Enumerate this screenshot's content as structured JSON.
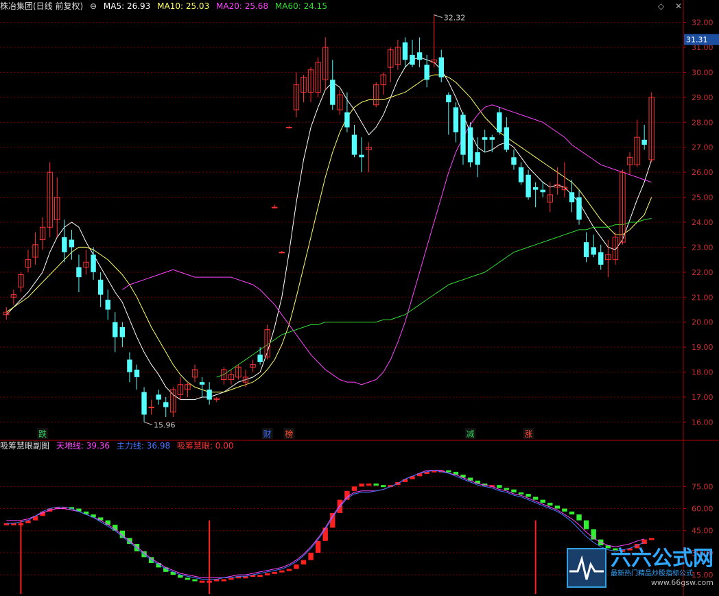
{
  "header": {
    "title": "株冶集团(日线 前复权)",
    "ma5_label": "MA5: 26.93",
    "ma10_label": "MA10: 25.03",
    "ma20_label": "MA20: 25.68",
    "ma60_label": "MA60: 24.15",
    "icons": [
      "diamond-icon",
      "close-icon"
    ]
  },
  "sub_header": {
    "title": "吸筹慧眼副图",
    "tiandi_label": "天地线: 39.36",
    "zhuli_label": "主力线: 36.98",
    "xichou_label": "吸筹慧眼: 0.00"
  },
  "current_price": "31.31",
  "high_label": "32.32",
  "low_label": "15.96",
  "watermark": {
    "title": "六六公式网",
    "slogan": "最新热门精品炒股指标公式",
    "url": "www.66gsw.com"
  },
  "colors": {
    "up": "#ff3232",
    "down": "#54ffff",
    "ma5": "#ffffff",
    "ma10": "#ffff66",
    "ma20": "#ff44ff",
    "ma60": "#33dd33",
    "tiandi": "#ff44ff",
    "zhuli": "#4477ff",
    "grid": "#7a0000",
    "axis": "#b00000"
  },
  "chart_data": [
    {
      "type": "candlestick",
      "title": "株冶集团(日线 前复权)",
      "ylim": [
        15.6,
        32.4
      ],
      "y_ticks": [
        "16.00",
        "17.00",
        "18.00",
        "19.00",
        "20.00",
        "21.00",
        "22.00",
        "23.00",
        "24.00",
        "25.00",
        "26.00",
        "27.00",
        "28.00",
        "29.00",
        "30.00",
        "31.00",
        "32.00"
      ],
      "candles": [
        [
          20.3,
          20.6,
          20.1,
          20.4
        ],
        [
          21.0,
          21.3,
          20.7,
          21.1
        ],
        [
          21.4,
          22.0,
          21.2,
          21.9
        ],
        [
          22.2,
          22.9,
          22.0,
          22.5
        ],
        [
          22.6,
          23.6,
          22.3,
          23.1
        ],
        [
          23.3,
          24.2,
          22.9,
          23.8
        ],
        [
          23.8,
          26.4,
          23.4,
          26.0
        ],
        [
          24.1,
          25.8,
          23.4,
          25.0
        ],
        [
          23.4,
          24.1,
          22.4,
          22.8
        ],
        [
          23.3,
          23.7,
          22.5,
          23.0
        ],
        [
          22.2,
          22.7,
          21.2,
          21.8
        ],
        [
          22.2,
          22.9,
          21.9,
          22.4
        ],
        [
          22.7,
          23.0,
          21.7,
          22.0
        ],
        [
          21.7,
          22.0,
          20.6,
          21.1
        ],
        [
          20.9,
          21.3,
          20.1,
          20.5
        ],
        [
          20.0,
          20.4,
          18.8,
          19.4
        ],
        [
          19.8,
          20.0,
          19.0,
          19.4
        ],
        [
          18.5,
          18.8,
          17.6,
          18.0
        ],
        [
          18.1,
          18.3,
          17.3,
          17.8
        ],
        [
          17.2,
          17.4,
          16.0,
          16.3
        ],
        [
          16.6,
          16.9,
          16.3,
          16.6
        ],
        [
          17.1,
          17.3,
          16.7,
          16.9
        ],
        [
          16.8,
          17.0,
          16.2,
          16.6
        ],
        [
          16.4,
          17.4,
          16.2,
          17.3
        ],
        [
          17.1,
          17.8,
          16.9,
          17.5
        ],
        [
          17.3,
          17.6,
          17.0,
          17.5
        ],
        [
          17.8,
          18.3,
          17.6,
          18.1
        ],
        [
          17.6,
          17.8,
          17.0,
          17.5
        ],
        [
          17.3,
          17.6,
          16.7,
          16.9
        ],
        [
          16.9,
          17.0,
          16.8,
          16.95
        ],
        [
          17.7,
          18.2,
          17.5,
          18.1
        ],
        [
          17.7,
          18.1,
          17.5,
          17.9
        ],
        [
          17.8,
          18.3,
          17.7,
          18.2
        ],
        [
          17.6,
          18.1,
          17.4,
          17.8
        ],
        [
          18.2,
          18.5,
          18.0,
          18.3
        ],
        [
          18.7,
          19.0,
          18.3,
          18.4
        ],
        [
          18.6,
          19.9,
          18.5,
          19.7
        ],
        [
          24.6,
          24.7,
          24.55,
          24.6
        ],
        [
          22.8,
          22.85,
          22.75,
          22.8
        ],
        [
          27.8,
          27.85,
          27.75,
          27.8
        ],
        [
          28.5,
          30.0,
          28.2,
          29.5
        ],
        [
          29.2,
          29.9,
          28.8,
          29.8
        ],
        [
          29.2,
          30.2,
          28.8,
          30.1
        ],
        [
          29.2,
          30.6,
          29.0,
          30.4
        ],
        [
          29.7,
          31.4,
          29.3,
          31.0
        ],
        [
          29.7,
          30.5,
          28.5,
          28.7
        ],
        [
          28.5,
          29.3,
          28.3,
          29.1
        ],
        [
          28.4,
          29.2,
          27.6,
          27.8
        ],
        [
          27.5,
          27.9,
          26.6,
          26.7
        ],
        [
          26.7,
          27.4,
          26.0,
          26.6
        ],
        [
          26.9,
          27.2,
          26.0,
          27.0
        ],
        [
          28.7,
          29.6,
          28.6,
          29.5
        ],
        [
          29.5,
          30.0,
          29.1,
          29.9
        ],
        [
          30.2,
          31.0,
          29.6,
          30.9
        ],
        [
          30.3,
          31.3,
          30.1,
          31.0
        ],
        [
          31.2,
          31.4,
          30.2,
          30.5
        ],
        [
          30.7,
          31.3,
          30.2,
          30.3
        ],
        [
          30.8,
          31.4,
          30.2,
          30.5
        ],
        [
          30.3,
          30.7,
          29.4,
          29.7
        ],
        [
          30.4,
          32.3,
          30.2,
          30.5
        ],
        [
          30.6,
          30.9,
          29.6,
          29.8
        ],
        [
          29.1,
          29.2,
          27.5,
          28.8
        ],
        [
          28.6,
          28.8,
          27.2,
          27.6
        ],
        [
          28.3,
          28.4,
          26.3,
          26.7
        ],
        [
          27.8,
          28.0,
          26.2,
          26.4
        ],
        [
          26.8,
          27.4,
          25.8,
          26.3
        ],
        [
          27.4,
          27.7,
          26.8,
          27.3
        ],
        [
          27.4,
          27.5,
          26.8,
          27.3
        ],
        [
          28.4,
          28.6,
          27.5,
          27.6
        ],
        [
          27.8,
          28.2,
          26.8,
          26.9
        ],
        [
          26.6,
          26.9,
          26.1,
          26.3
        ],
        [
          26.2,
          26.4,
          25.5,
          25.6
        ],
        [
          25.9,
          26.1,
          24.9,
          25.0
        ],
        [
          25.4,
          25.6,
          24.6,
          25.3
        ],
        [
          25.3,
          25.6,
          25.0,
          25.2
        ],
        [
          24.8,
          25.6,
          24.4,
          25.1
        ],
        [
          25.4,
          26.2,
          25.1,
          25.5
        ],
        [
          25.3,
          26.4,
          25.0,
          25.4
        ],
        [
          25.2,
          25.7,
          24.4,
          24.8
        ],
        [
          25.0,
          25.3,
          23.9,
          24.1
        ],
        [
          23.2,
          23.6,
          22.4,
          22.6
        ],
        [
          23.0,
          23.5,
          22.6,
          22.7
        ],
        [
          22.8,
          23.1,
          22.1,
          22.3
        ],
        [
          22.5,
          23.3,
          21.8,
          22.7
        ],
        [
          22.5,
          23.6,
          22.3,
          23.4
        ],
        [
          23.2,
          26.1,
          23.1,
          26.0
        ],
        [
          26.3,
          26.8,
          25.9,
          26.6
        ],
        [
          26.3,
          28.1,
          26.2,
          27.4
        ],
        [
          27.3,
          27.9,
          26.9,
          27.1
        ],
        [
          26.5,
          29.2,
          26.4,
          29.0
        ]
      ],
      "series": [
        {
          "name": "MA5",
          "values": [
            20.3,
            20.6,
            20.9,
            21.2,
            21.6,
            22.0,
            22.8,
            23.4,
            23.8,
            24.0,
            23.8,
            23.2,
            22.7,
            22.2,
            21.7,
            21.2,
            20.8,
            20.1,
            19.4,
            18.8,
            18.3,
            17.9,
            17.4,
            17.1,
            16.9,
            16.9,
            16.9,
            17.0,
            17.0,
            17.1,
            17.2,
            17.4,
            17.6,
            17.7,
            17.8,
            18.0,
            18.8,
            19.8,
            21.0,
            22.8,
            24.8,
            26.5,
            27.8,
            28.6,
            29.3,
            29.6,
            29.4,
            28.9,
            28.5,
            28.0,
            27.5,
            27.8,
            28.3,
            29.0,
            29.7,
            30.2,
            30.5,
            30.6,
            30.5,
            30.4,
            30.1,
            29.6,
            29.0,
            28.3,
            27.6,
            27.0,
            26.8,
            26.9,
            27.1,
            27.2,
            27.0,
            26.6,
            26.2,
            25.9,
            25.6,
            25.4,
            25.5,
            25.4,
            25.1,
            24.8,
            24.3,
            23.8,
            23.4,
            23.0,
            22.9,
            23.3,
            24.1,
            24.9,
            25.6,
            26.5
          ]
        },
        {
          "name": "MA10",
          "values": [
            20.4,
            20.6,
            20.8,
            21.0,
            21.3,
            21.6,
            21.9,
            22.2,
            22.5,
            22.8,
            23.0,
            23.0,
            22.9,
            22.7,
            22.5,
            22.2,
            21.9,
            21.5,
            21.0,
            20.4,
            19.8,
            19.3,
            18.8,
            18.3,
            17.9,
            17.6,
            17.4,
            17.3,
            17.2,
            17.2,
            17.2,
            17.3,
            17.4,
            17.5,
            17.6,
            17.8,
            18.1,
            18.5,
            19.1,
            19.9,
            21.0,
            22.2,
            23.4,
            24.6,
            25.8,
            26.8,
            27.6,
            28.2,
            28.6,
            28.8,
            28.9,
            28.9,
            28.9,
            29.0,
            29.1,
            29.2,
            29.4,
            29.6,
            29.8,
            29.9,
            29.9,
            29.8,
            29.6,
            29.3,
            29.0,
            28.6,
            28.2,
            27.9,
            27.6,
            27.4,
            27.2,
            27.0,
            26.8,
            26.6,
            26.4,
            26.2,
            26.0,
            25.8,
            25.6,
            25.3,
            24.9,
            24.5,
            24.1,
            23.8,
            23.5,
            23.5,
            23.7,
            24.0,
            24.3,
            25.0
          ]
        },
        {
          "name": "MA20",
          "values": [
            21.3,
            21.5,
            21.6,
            21.7,
            21.8,
            21.9,
            22.0,
            22.1,
            22.0,
            21.9,
            21.8,
            21.8,
            21.8,
            21.8,
            21.8,
            21.8,
            21.7,
            21.6,
            21.5,
            21.3,
            21.0,
            20.7,
            20.3,
            19.9,
            19.5,
            19.1,
            18.7,
            18.4,
            18.1,
            17.9,
            17.7,
            17.6,
            17.6,
            17.5,
            17.6,
            17.7,
            18.0,
            18.5,
            19.2,
            20.0,
            21.0,
            22.0,
            23.0,
            24.0,
            25.0,
            26.0,
            26.8,
            27.4,
            27.9,
            28.3,
            28.6,
            28.7,
            28.6,
            28.5,
            28.4,
            28.3,
            28.2,
            28.1,
            28.0,
            27.8,
            27.6,
            27.4,
            27.1,
            26.9,
            26.7,
            26.5,
            26.3,
            26.2,
            26.1,
            26.0,
            25.9,
            25.8,
            25.7,
            25.6
          ]
        },
        {
          "name": "MA60",
          "values": [
            17.8,
            17.9,
            18.1,
            18.3,
            18.5,
            18.7,
            18.9,
            19.1,
            19.3,
            19.5,
            19.6,
            19.7,
            19.8,
            19.9,
            19.9,
            20.0,
            20.0,
            20.0,
            20.0,
            20.0,
            20.0,
            20.0,
            20.0,
            20.1,
            20.1,
            20.2,
            20.3,
            20.5,
            20.7,
            20.9,
            21.1,
            21.3,
            21.5,
            21.6,
            21.7,
            21.8,
            21.9,
            22.0,
            22.2,
            22.4,
            22.6,
            22.8,
            22.9,
            23.0,
            23.1,
            23.2,
            23.3,
            23.4,
            23.5,
            23.6,
            23.7,
            23.7,
            23.8,
            23.8,
            23.8,
            23.9,
            23.9,
            24.0,
            24.0,
            24.1,
            24.15
          ]
        }
      ],
      "markers": [
        {
          "label": "跌",
          "color": "#2fd25a"
        },
        {
          "label": "财",
          "color": "#3a6bff"
        },
        {
          "label": "榜",
          "color": "#ff4a2a"
        },
        {
          "label": "减",
          "color": "#2fd25a"
        },
        {
          "label": "涨",
          "color": "#ff4a2a"
        }
      ]
    },
    {
      "type": "bar",
      "title": "吸筹慧眼副图",
      "ylim": [
        2,
        98
      ],
      "y_ticks": [
        "15.00",
        "30.00",
        "45.00",
        "60.00",
        "75.00"
      ],
      "values": [
        50,
        50,
        50,
        52,
        55,
        58,
        60,
        61,
        61,
        60,
        58,
        56,
        54,
        52,
        49,
        45,
        40,
        36,
        31,
        27,
        23,
        20,
        17,
        15,
        13,
        12,
        11,
        11,
        11,
        12,
        12,
        13,
        14,
        14,
        15,
        15,
        16,
        17,
        18,
        19,
        22,
        25,
        30,
        38,
        47,
        57,
        66,
        72,
        75,
        77,
        77,
        76,
        75,
        76,
        78,
        80,
        82,
        84,
        85,
        86,
        86,
        85,
        83,
        81,
        79,
        77,
        76,
        76,
        74,
        73,
        71,
        70,
        68,
        66,
        64,
        62,
        60,
        58,
        56,
        52,
        46,
        39,
        35,
        33,
        32,
        32,
        33,
        36,
        39,
        40
      ],
      "series": [
        {
          "name": "天地线",
          "values": [
            52,
            52,
            52,
            53,
            55,
            57,
            59,
            60,
            60,
            59,
            58,
            56,
            54,
            52,
            49,
            46,
            42,
            38,
            34,
            30,
            26,
            23,
            20,
            18,
            16,
            15,
            14,
            13,
            13,
            13,
            13,
            14,
            15,
            15,
            16,
            17,
            18,
            19,
            20,
            22,
            25,
            29,
            34,
            40,
            47,
            55,
            62,
            68,
            71,
            72,
            72,
            72,
            73,
            75,
            77,
            80,
            82,
            84,
            86,
            86,
            86,
            84,
            83,
            81,
            79,
            77,
            76,
            75,
            73,
            72,
            70,
            69,
            67,
            65,
            63,
            61,
            59,
            56,
            53,
            49,
            44,
            40,
            37,
            35,
            34,
            35,
            36,
            38,
            39.36
          ]
        },
        {
          "name": "主力线",
          "values": [
            50,
            50,
            51,
            52,
            55,
            58,
            60,
            61,
            61,
            60,
            58,
            56,
            54,
            51,
            48,
            45,
            41,
            37,
            33,
            29,
            25,
            22,
            19,
            17,
            15,
            14,
            13,
            12,
            12,
            12,
            13,
            13,
            14,
            14,
            15,
            16,
            17,
            18,
            19,
            21,
            24,
            28,
            33,
            39,
            46,
            54,
            61,
            67,
            70,
            71,
            71,
            72,
            73,
            75,
            77,
            80,
            82,
            84,
            85,
            86,
            85,
            84,
            82,
            80,
            78,
            76,
            75,
            74,
            72,
            71,
            69,
            68,
            66,
            64,
            62,
            60,
            58,
            55,
            51,
            46,
            41,
            37,
            34,
            32,
            31,
            32,
            33,
            35,
            36.98
          ]
        }
      ],
      "signal_bars": [
        2,
        28,
        73
      ]
    }
  ]
}
